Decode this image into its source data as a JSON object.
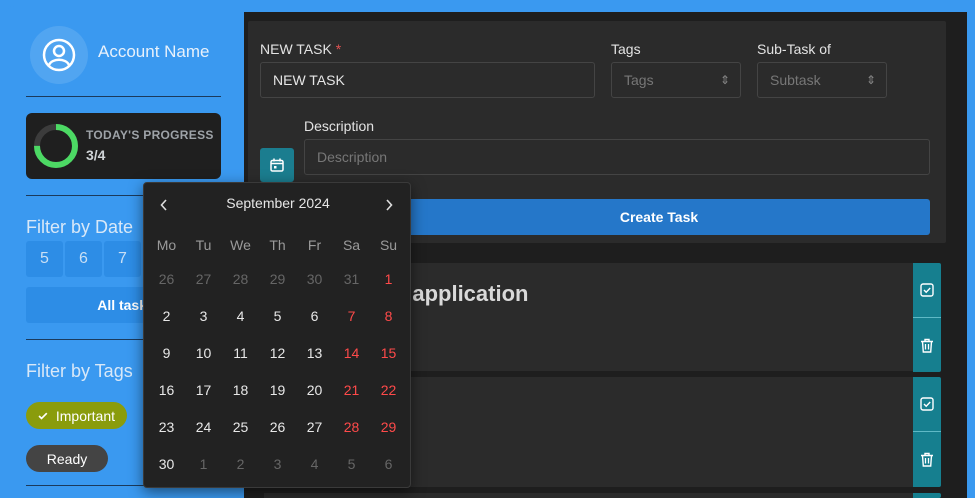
{
  "sidebar": {
    "account_name": "Account Name",
    "progress": {
      "title": "TODAY'S PROGRESS",
      "value": "3/4",
      "fraction": 0.75,
      "color": "#4cd964"
    },
    "filter_date_title": "Filter by Date",
    "dates": [
      "5",
      "6",
      "7"
    ],
    "all_tasks_label": "All tasks",
    "filter_tags_title": "Filter by Tags",
    "tags": [
      {
        "label": "Important",
        "selected": true,
        "color": "#8a9c0c"
      },
      {
        "label": "Ready",
        "selected": false,
        "color": "#444444"
      }
    ]
  },
  "form": {
    "new_task_label": "NEW TASK",
    "required_mark": "*",
    "new_task_value": "NEW TASK",
    "tags_label": "Tags",
    "tags_placeholder": "Tags",
    "subtask_label": "Sub-Task of",
    "subtask_placeholder": "Subtask",
    "description_label": "Description",
    "description_placeholder": "Description",
    "create_button": "Create Task"
  },
  "tasks": [
    {
      "title_visible": "s application"
    },
    {
      "title_visible": ""
    }
  ],
  "date_picker": {
    "month_label": "September 2024",
    "weekdays": [
      "Mo",
      "Tu",
      "We",
      "Th",
      "Fr",
      "Sa",
      "Su"
    ],
    "weeks": [
      [
        {
          "d": "26",
          "m": true
        },
        {
          "d": "27",
          "m": true
        },
        {
          "d": "28",
          "m": true
        },
        {
          "d": "29",
          "m": true
        },
        {
          "d": "30",
          "m": true
        },
        {
          "d": "31",
          "m": true
        },
        {
          "d": "1",
          "w": true
        }
      ],
      [
        {
          "d": "2"
        },
        {
          "d": "3"
        },
        {
          "d": "4"
        },
        {
          "d": "5"
        },
        {
          "d": "6"
        },
        {
          "d": "7",
          "w": true
        },
        {
          "d": "8",
          "w": true
        }
      ],
      [
        {
          "d": "9"
        },
        {
          "d": "10"
        },
        {
          "d": "11"
        },
        {
          "d": "12"
        },
        {
          "d": "13"
        },
        {
          "d": "14",
          "w": true
        },
        {
          "d": "15",
          "w": true
        }
      ],
      [
        {
          "d": "16"
        },
        {
          "d": "17"
        },
        {
          "d": "18"
        },
        {
          "d": "19"
        },
        {
          "d": "20"
        },
        {
          "d": "21",
          "w": true
        },
        {
          "d": "22",
          "w": true
        }
      ],
      [
        {
          "d": "23"
        },
        {
          "d": "24"
        },
        {
          "d": "25"
        },
        {
          "d": "26"
        },
        {
          "d": "27"
        },
        {
          "d": "28",
          "w": true
        },
        {
          "d": "29",
          "w": true
        }
      ],
      [
        {
          "d": "30"
        },
        {
          "d": "1",
          "m": true
        },
        {
          "d": "2",
          "m": true
        },
        {
          "d": "3",
          "m": true
        },
        {
          "d": "4",
          "m": true
        },
        {
          "d": "5",
          "m": true
        },
        {
          "d": "6",
          "m": true
        }
      ]
    ]
  },
  "colors": {
    "accent": "#3a99f0",
    "primary_button": "#2577c9",
    "action": "#167f8f",
    "weekend": "#ff4a4a"
  }
}
